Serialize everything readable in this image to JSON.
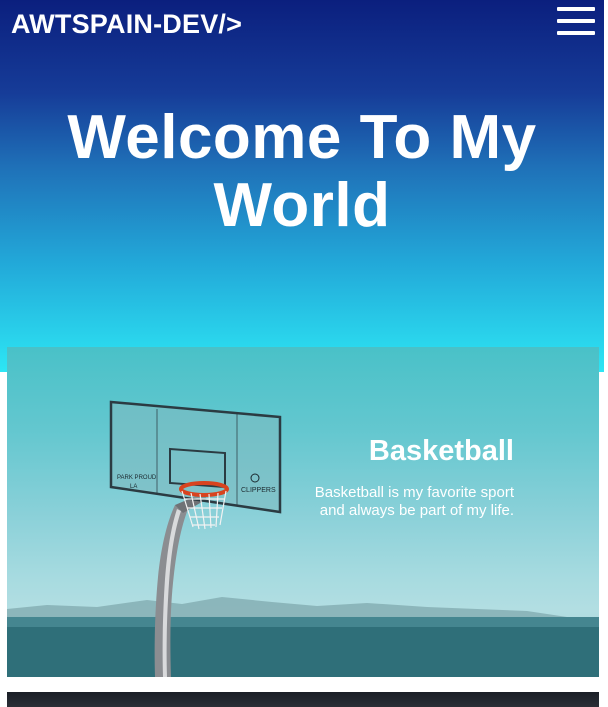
{
  "header": {
    "brand": "AWTSPAIN-DEV/>",
    "menu_icon": "hamburger-menu-icon"
  },
  "hero": {
    "title": "Welcome To My World"
  },
  "cards": [
    {
      "title": "Basketball",
      "description": "Basketball is my favorite sport and always be part of my life.",
      "image": "basketball-hoop-photo",
      "backboard_text": [
        "PARK PROUD",
        "LA",
        "CLIPPERS"
      ]
    }
  ],
  "colors": {
    "hero_top": "#0b1f7e",
    "hero_bottom": "#2de6f4",
    "text": "#ffffff",
    "card_sky": "#63c7cf"
  }
}
